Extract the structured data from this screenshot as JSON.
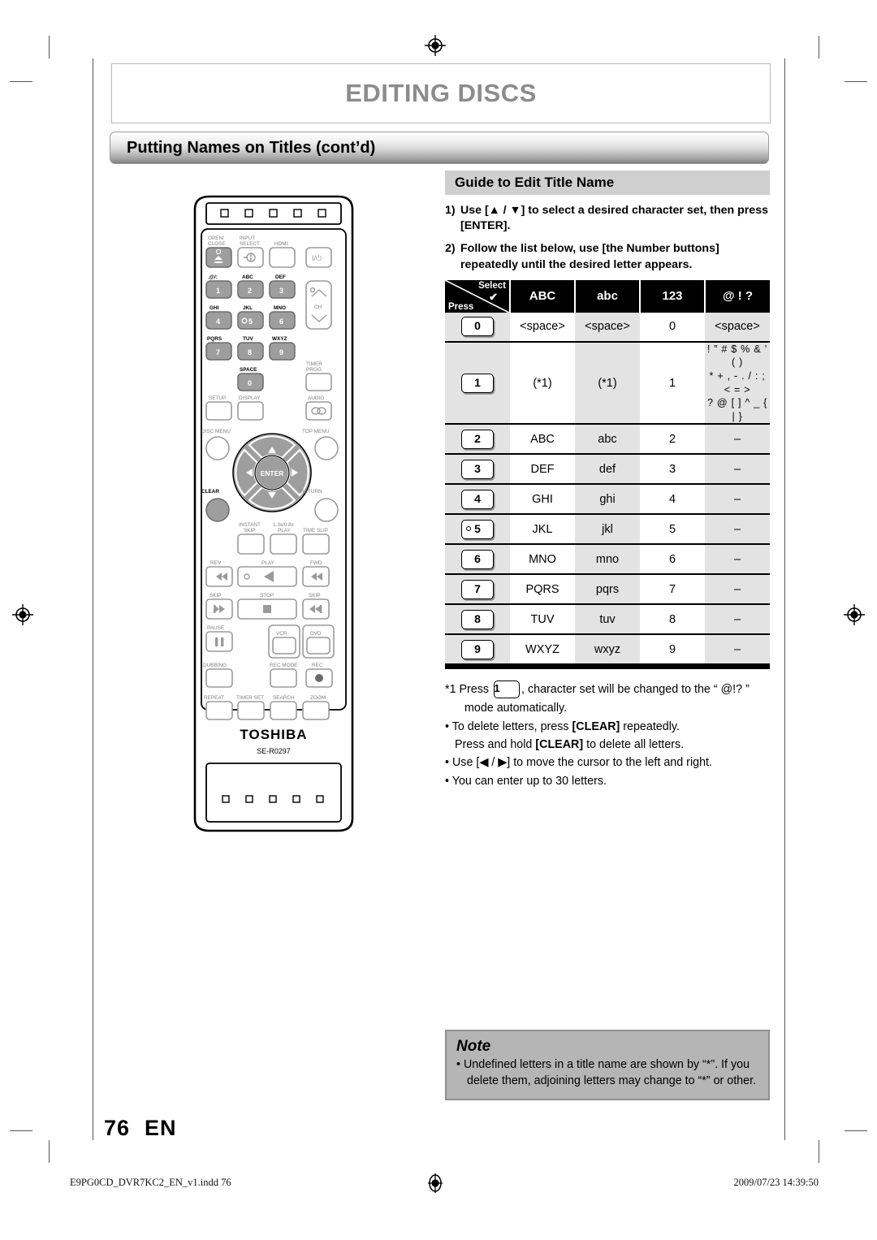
{
  "chapter": {
    "title": "EDITING DISCS"
  },
  "section": {
    "title": "Putting Names on Titles (cont’d)"
  },
  "guide": {
    "heading": "Guide to Edit Title Name",
    "steps": [
      {
        "num": "1)",
        "text": "Use [▲ / ▼] to select a desired character set, then press [ENTER]."
      },
      {
        "num": "2)",
        "text": "Follow the list below, use [the Number buttons] repeatedly until the desired letter appears."
      }
    ]
  },
  "table": {
    "corner": {
      "select": "Select",
      "press": "Press",
      "check": "✔"
    },
    "columns": [
      "ABC",
      "abc",
      "123",
      "@ ! ?"
    ],
    "rows": [
      {
        "key": "0",
        "key_dot": false,
        "abc": "<space>",
        "abc_lower": "<space>",
        "num": "0",
        "sym": "<space>",
        "tall": false
      },
      {
        "key": "1",
        "key_dot": false,
        "abc": "(*1)",
        "abc_lower": "(*1)",
        "num": "1",
        "sym": "! ” # $ % & ’ ( )\n* + , - . / : ; < = >\n? @ [ ] ^ _ { | }",
        "tall": true
      },
      {
        "key": "2",
        "key_dot": false,
        "abc": "ABC",
        "abc_lower": "abc",
        "num": "2",
        "sym": "–",
        "tall": false
      },
      {
        "key": "3",
        "key_dot": false,
        "abc": "DEF",
        "abc_lower": "def",
        "num": "3",
        "sym": "–",
        "tall": false
      },
      {
        "key": "4",
        "key_dot": false,
        "abc": "GHI",
        "abc_lower": "ghi",
        "num": "4",
        "sym": "–",
        "tall": false
      },
      {
        "key": "5",
        "key_dot": true,
        "abc": "JKL",
        "abc_lower": "jkl",
        "num": "5",
        "sym": "–",
        "tall": false
      },
      {
        "key": "6",
        "key_dot": false,
        "abc": "MNO",
        "abc_lower": "mno",
        "num": "6",
        "sym": "–",
        "tall": false
      },
      {
        "key": "7",
        "key_dot": false,
        "abc": "PQRS",
        "abc_lower": "pqrs",
        "num": "7",
        "sym": "–",
        "tall": false
      },
      {
        "key": "8",
        "key_dot": false,
        "abc": "TUV",
        "abc_lower": "tuv",
        "num": "8",
        "sym": "–",
        "tall": false
      },
      {
        "key": "9",
        "key_dot": false,
        "abc": "WXYZ",
        "abc_lower": "wxyz",
        "num": "9",
        "sym": "–",
        "tall": false
      }
    ]
  },
  "footnotes": {
    "star1_pre": "*1 Press",
    "star1_key": "1",
    "star1_post": ", character set will be changed to the “ @!? ”",
    "star1_line2": "mode automatically.",
    "b1_a": "• To delete letters, press ",
    "b1_clear": "[CLEAR]",
    "b1_b": " repeatedly.",
    "b2_a": "Press and hold ",
    "b2_clear": "[CLEAR]",
    "b2_b": " to delete all letters.",
    "b3": "• Use [◀ / ▶] to move the cursor to the left and right.",
    "b4": "• You can enter up to 30 letters."
  },
  "note": {
    "heading": "Note",
    "body": "• Undefined letters in a title name are shown by “*”. If you delete them, adjoining letters may change to “*” or other."
  },
  "page": {
    "number": "76",
    "lang": "EN"
  },
  "footer": {
    "file": "E9PG0CD_DVR7KC2_EN_v1.indd   76",
    "stamp": "2009/07/23   14:39:50"
  },
  "remote": {
    "brand": "TOSHIBA",
    "model": "SE-R0297",
    "labels": {
      "open_close": "OPEN/\nCLOSE",
      "input_select": "INPUT\nSELECT",
      "hdmi": "HDMI",
      "power": "I/⏻",
      "k1": ".@/:",
      "k2": "ABC",
      "k3": "DEF",
      "k4": "GHI",
      "k5": "JKL",
      "k6": "MNO",
      "k7": "PQRS",
      "k8": "TUV",
      "k9": "WXYZ",
      "k0": "SPACE",
      "ch": "CH",
      "timer_prog": "TIMER\nPROG.",
      "setup": "SETUP",
      "display": "DISPLAY",
      "audio": "AUDIO",
      "disc_menu": "DISC MENU",
      "top_menu": "TOP MENU",
      "enter": "ENTER",
      "clear": "CLEAR",
      "return": "RETURN",
      "instant_skip": "INSTANT\nSKIP",
      "play_speed": "1.3x/0.8x\nPLAY",
      "time_slip": "TIME SLIP",
      "rev": "REV",
      "play": "PLAY",
      "fwd": "FWD",
      "skip_back": "SKIP",
      "stop": "STOP",
      "skip_fwd": "SKIP",
      "pause": "PAUSE",
      "vcr": "VCR",
      "dvd": "DVD",
      "dubbing": "DUBBING",
      "rec_mode": "REC MODE",
      "rec": "REC",
      "repeat": "REPEAT",
      "timer_set": "TIMER SET",
      "search": "SEARCH",
      "zoom": "ZOOM"
    }
  }
}
